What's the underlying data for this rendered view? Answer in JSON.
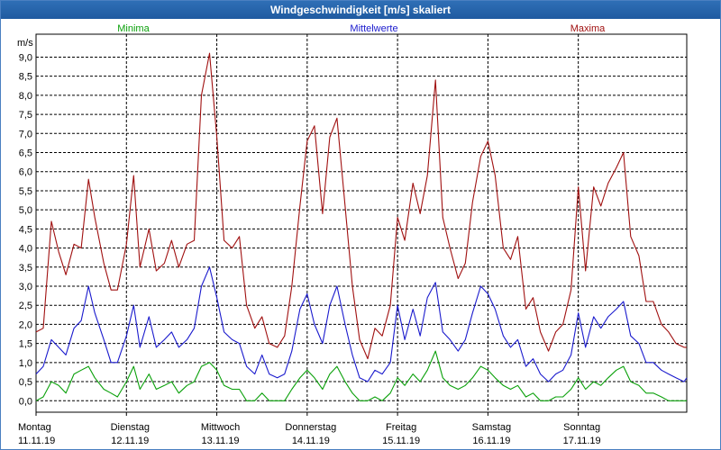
{
  "window": {
    "title": "Windgeschwindigkeit [m/s] skaliert"
  },
  "colors": {
    "minima": "#0aa00a",
    "mittel": "#1a1acd",
    "maxima": "#a01010",
    "grid": "#000000",
    "axis": "#000000"
  },
  "chart_data": {
    "type": "line",
    "ylabel": "m/s",
    "ylim": [
      -0.3,
      9.6
    ],
    "yticks": [
      0.0,
      0.5,
      1.0,
      1.5,
      2.0,
      2.5,
      3.0,
      3.5,
      4.0,
      4.5,
      5.0,
      5.5,
      6.0,
      6.5,
      7.0,
      7.5,
      8.0,
      8.5,
      9.0
    ],
    "ytick_labels": [
      "0,0",
      "0,5",
      "1,0",
      "1,5",
      "2,0",
      "2,5",
      "3,0",
      "3,5",
      "4,0",
      "4,5",
      "5,0",
      "5,5",
      "6,0",
      "6,5",
      "7,0",
      "7,5",
      "8,0",
      "8,5",
      "9,0"
    ],
    "days": [
      {
        "name": "Montag",
        "date": "11.11.19"
      },
      {
        "name": "Dienstag",
        "date": "12.11.19"
      },
      {
        "name": "Mittwoch",
        "date": "13.11.19"
      },
      {
        "name": "Donnerstag",
        "date": "14.11.19"
      },
      {
        "name": "Freitag",
        "date": "15.11.19"
      },
      {
        "name": "Samstag",
        "date": "16.11.19"
      },
      {
        "name": "Sonntag",
        "date": "17.11.19"
      }
    ],
    "xlim": [
      0,
      7.2
    ],
    "legend": {
      "minima": "Minima",
      "mittel": "Mittelwerte",
      "maxima": "Maxima"
    },
    "series": [
      {
        "name": "Maxima",
        "x": [
          0.0,
          0.08,
          0.17,
          0.25,
          0.33,
          0.42,
          0.5,
          0.58,
          0.65,
          0.75,
          0.83,
          0.9,
          1.0,
          1.08,
          1.15,
          1.25,
          1.33,
          1.42,
          1.5,
          1.58,
          1.67,
          1.75,
          1.83,
          1.92,
          2.0,
          2.08,
          2.17,
          2.25,
          2.33,
          2.42,
          2.5,
          2.58,
          2.67,
          2.75,
          2.83,
          2.92,
          3.0,
          3.08,
          3.17,
          3.25,
          3.33,
          3.42,
          3.5,
          3.58,
          3.67,
          3.75,
          3.83,
          3.92,
          4.0,
          4.08,
          4.17,
          4.25,
          4.33,
          4.42,
          4.5,
          4.58,
          4.67,
          4.75,
          4.83,
          4.92,
          5.0,
          5.08,
          5.17,
          5.25,
          5.33,
          5.42,
          5.5,
          5.58,
          5.67,
          5.75,
          5.83,
          5.92,
          6.0,
          6.08,
          6.17,
          6.25,
          6.33,
          6.42,
          6.5,
          6.58,
          6.67,
          6.75,
          6.83,
          6.92,
          7.0,
          7.08,
          7.17,
          7.2
        ],
        "values": [
          1.8,
          1.9,
          4.7,
          3.9,
          3.3,
          4.1,
          4.0,
          5.8,
          4.8,
          3.6,
          2.9,
          2.9,
          4.1,
          5.9,
          3.5,
          4.5,
          3.4,
          3.6,
          4.2,
          3.5,
          4.1,
          4.2,
          8.0,
          9.1,
          6.9,
          4.2,
          4.0,
          4.3,
          2.5,
          1.9,
          2.2,
          1.5,
          1.4,
          1.7,
          3.0,
          5.1,
          6.8,
          7.2,
          4.9,
          6.9,
          7.4,
          5.1,
          3.0,
          1.6,
          1.1,
          1.9,
          1.7,
          2.5,
          4.8,
          4.2,
          5.7,
          4.9,
          5.9,
          8.4,
          4.8,
          4.0,
          3.2,
          3.6,
          5.2,
          6.4,
          6.8,
          5.9,
          4.0,
          3.7,
          4.3,
          2.4,
          2.7,
          1.8,
          1.3,
          1.8,
          2.0,
          2.9,
          5.6,
          3.4,
          5.6,
          5.1,
          5.7,
          6.1,
          6.5,
          4.3,
          3.8,
          2.6,
          2.6,
          2.0,
          1.8,
          1.5,
          1.4,
          1.4
        ]
      },
      {
        "name": "Mittelwerte",
        "x": [
          0.0,
          0.08,
          0.17,
          0.25,
          0.33,
          0.42,
          0.5,
          0.58,
          0.65,
          0.75,
          0.83,
          0.9,
          1.0,
          1.08,
          1.15,
          1.25,
          1.33,
          1.42,
          1.5,
          1.58,
          1.67,
          1.75,
          1.83,
          1.92,
          2.0,
          2.08,
          2.17,
          2.25,
          2.33,
          2.42,
          2.5,
          2.58,
          2.67,
          2.75,
          2.83,
          2.92,
          3.0,
          3.08,
          3.17,
          3.25,
          3.33,
          3.42,
          3.5,
          3.58,
          3.67,
          3.75,
          3.83,
          3.92,
          4.0,
          4.08,
          4.17,
          4.25,
          4.33,
          4.42,
          4.5,
          4.58,
          4.67,
          4.75,
          4.83,
          4.92,
          5.0,
          5.08,
          5.17,
          5.25,
          5.33,
          5.42,
          5.5,
          5.58,
          5.67,
          5.75,
          5.83,
          5.92,
          6.0,
          6.08,
          6.17,
          6.25,
          6.33,
          6.42,
          6.5,
          6.58,
          6.67,
          6.75,
          6.83,
          6.92,
          7.0,
          7.08,
          7.17,
          7.2
        ],
        "values": [
          0.7,
          0.9,
          1.6,
          1.4,
          1.2,
          1.9,
          2.1,
          3.0,
          2.3,
          1.6,
          1.0,
          1.0,
          1.7,
          2.5,
          1.4,
          2.2,
          1.4,
          1.6,
          1.8,
          1.4,
          1.6,
          1.9,
          3.0,
          3.5,
          2.7,
          1.8,
          1.6,
          1.5,
          0.9,
          0.7,
          1.2,
          0.7,
          0.6,
          0.7,
          1.3,
          2.4,
          2.8,
          2.0,
          1.5,
          2.5,
          3.0,
          2.0,
          1.2,
          0.6,
          0.5,
          0.8,
          0.7,
          1.0,
          2.5,
          1.6,
          2.4,
          1.7,
          2.7,
          3.1,
          1.8,
          1.6,
          1.3,
          1.6,
          2.3,
          3.0,
          2.8,
          2.4,
          1.7,
          1.4,
          1.6,
          0.9,
          1.1,
          0.7,
          0.5,
          0.7,
          0.8,
          1.2,
          2.3,
          1.4,
          2.2,
          1.9,
          2.2,
          2.4,
          2.6,
          1.7,
          1.5,
          1.0,
          1.0,
          0.8,
          0.7,
          0.6,
          0.5,
          0.6
        ]
      },
      {
        "name": "Minima",
        "x": [
          0.0,
          0.08,
          0.17,
          0.25,
          0.33,
          0.42,
          0.5,
          0.58,
          0.65,
          0.75,
          0.83,
          0.9,
          1.0,
          1.08,
          1.15,
          1.25,
          1.33,
          1.42,
          1.5,
          1.58,
          1.67,
          1.75,
          1.83,
          1.92,
          2.0,
          2.08,
          2.17,
          2.25,
          2.33,
          2.42,
          2.5,
          2.58,
          2.67,
          2.75,
          2.83,
          2.92,
          3.0,
          3.08,
          3.17,
          3.25,
          3.33,
          3.42,
          3.5,
          3.58,
          3.67,
          3.75,
          3.83,
          3.92,
          4.0,
          4.08,
          4.17,
          4.25,
          4.33,
          4.42,
          4.5,
          4.58,
          4.67,
          4.75,
          4.83,
          4.92,
          5.0,
          5.08,
          5.17,
          5.25,
          5.33,
          5.42,
          5.5,
          5.58,
          5.67,
          5.75,
          5.83,
          5.92,
          6.0,
          6.08,
          6.17,
          6.25,
          6.33,
          6.42,
          6.5,
          6.58,
          6.67,
          6.75,
          6.83,
          6.92,
          7.0,
          7.08,
          7.17,
          7.2
        ],
        "values": [
          0.0,
          0.1,
          0.5,
          0.4,
          0.2,
          0.7,
          0.8,
          0.9,
          0.6,
          0.3,
          0.2,
          0.1,
          0.5,
          0.9,
          0.3,
          0.7,
          0.3,
          0.4,
          0.5,
          0.2,
          0.4,
          0.5,
          0.9,
          1.0,
          0.8,
          0.4,
          0.3,
          0.3,
          0.0,
          0.0,
          0.2,
          0.0,
          0.0,
          0.0,
          0.3,
          0.6,
          0.8,
          0.6,
          0.3,
          0.7,
          0.9,
          0.5,
          0.2,
          0.0,
          0.0,
          0.1,
          0.0,
          0.2,
          0.6,
          0.4,
          0.7,
          0.5,
          0.8,
          1.3,
          0.6,
          0.4,
          0.3,
          0.4,
          0.6,
          0.9,
          0.8,
          0.6,
          0.4,
          0.3,
          0.4,
          0.1,
          0.2,
          0.0,
          0.0,
          0.1,
          0.1,
          0.3,
          0.6,
          0.3,
          0.5,
          0.4,
          0.6,
          0.8,
          0.9,
          0.5,
          0.4,
          0.2,
          0.2,
          0.1,
          0.0,
          0.0,
          0.0,
          0.0
        ]
      }
    ]
  }
}
